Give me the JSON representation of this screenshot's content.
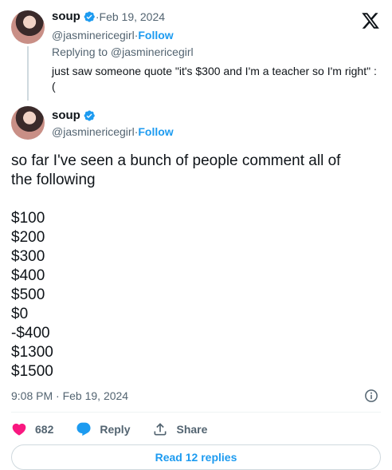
{
  "parent": {
    "name": "soup",
    "separator": " · ",
    "date": "Feb 19, 2024",
    "handle": "@jasminericegirl",
    "dot": " · ",
    "follow": "Follow",
    "replying_to": "Replying to @jasminericegirl",
    "text": "just saw someone quote \"it's $300 and I'm a teacher so I'm right\" :("
  },
  "tweet": {
    "name": "soup",
    "handle": "@jasminericegirl",
    "dot": " · ",
    "follow": "Follow",
    "lines": [
      "so far I've seen a bunch of people comment all of",
      "the following",
      "",
      "$100",
      "$200",
      "$300",
      "$400",
      "$500",
      "$0",
      "-$400",
      "$1300",
      "$1500"
    ],
    "timestamp": "9:08 PM · Feb 19, 2024"
  },
  "actions": {
    "likes": "682",
    "reply": "Reply",
    "share": "Share"
  },
  "read_replies": "Read 12 replies",
  "colors": {
    "accent": "#1d9bf0",
    "like": "#f91880",
    "muted": "#536471"
  },
  "icons": {
    "logo": "x-logo-icon",
    "verified": "verified-badge-icon",
    "info": "info-icon",
    "like": "heart-icon",
    "reply": "reply-bubble-icon",
    "share": "share-icon"
  }
}
